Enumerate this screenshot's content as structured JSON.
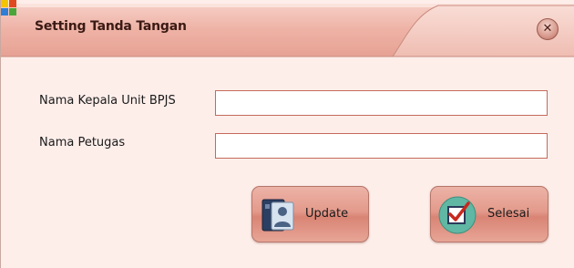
{
  "window": {
    "title": "Setting Tanda Tangan",
    "icons": {
      "app": "window-app-icon",
      "close": "close-icon"
    }
  },
  "form": {
    "kepala_label": "Nama Kepala Unit BPJS",
    "kepala_value": "",
    "petugas_label": "Nama Petugas",
    "petugas_value": ""
  },
  "buttons": {
    "update_label": "Update",
    "update_icon": "user-id-card-icon",
    "selesai_label": "Selesai",
    "selesai_icon": "checkbox-checked-icon"
  },
  "colors": {
    "background": "#fdeeea",
    "titlebar": "#f0b5a8",
    "field_border": "#c46a5c",
    "button": "#e39a8b"
  }
}
